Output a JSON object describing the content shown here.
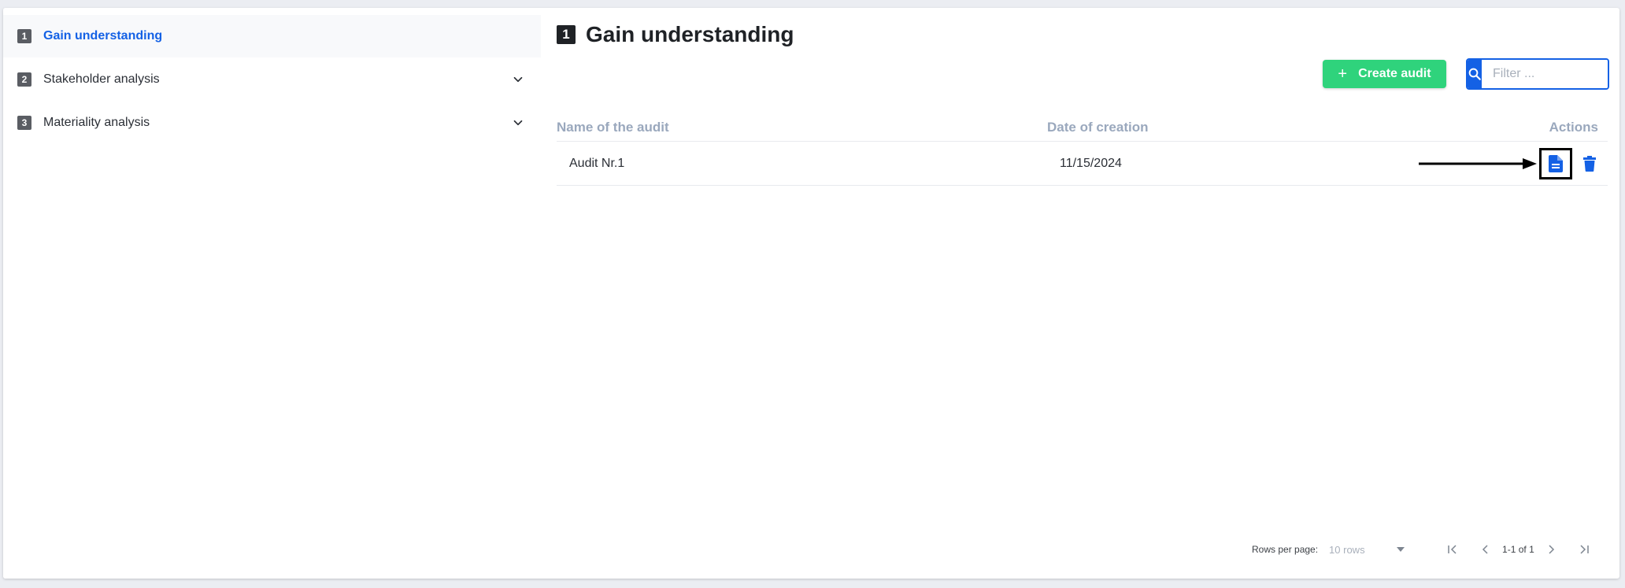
{
  "sidebar": {
    "items": [
      {
        "num": "1",
        "label": "Gain understanding"
      },
      {
        "num": "2",
        "label": "Stakeholder analysis"
      },
      {
        "num": "3",
        "label": "Materiality analysis"
      }
    ]
  },
  "main": {
    "title_num": "1",
    "title": "Gain understanding",
    "create_label": "Create audit",
    "filter_placeholder": "Filter ...",
    "table": {
      "headers": {
        "name": "Name of the audit",
        "date": "Date of creation",
        "actions": "Actions"
      },
      "rows": [
        {
          "name": "Audit Nr.1",
          "date": "11/15/2024"
        }
      ]
    },
    "pagination": {
      "rows_per_page_label": "Rows per page:",
      "rows_per_page_value": "10 rows",
      "range": "1-1 of 1"
    }
  },
  "colors": {
    "accent": "#1461e5",
    "create_button": "#2fd37c",
    "header_text": "#9aa8bd"
  },
  "icons": [
    "chevron-down-icon",
    "search-icon",
    "plus-icon",
    "document-icon",
    "trash-icon",
    "arrow-right-icon",
    "first-page-icon",
    "prev-page-icon",
    "next-page-icon",
    "last-page-icon",
    "caret-down-icon"
  ]
}
